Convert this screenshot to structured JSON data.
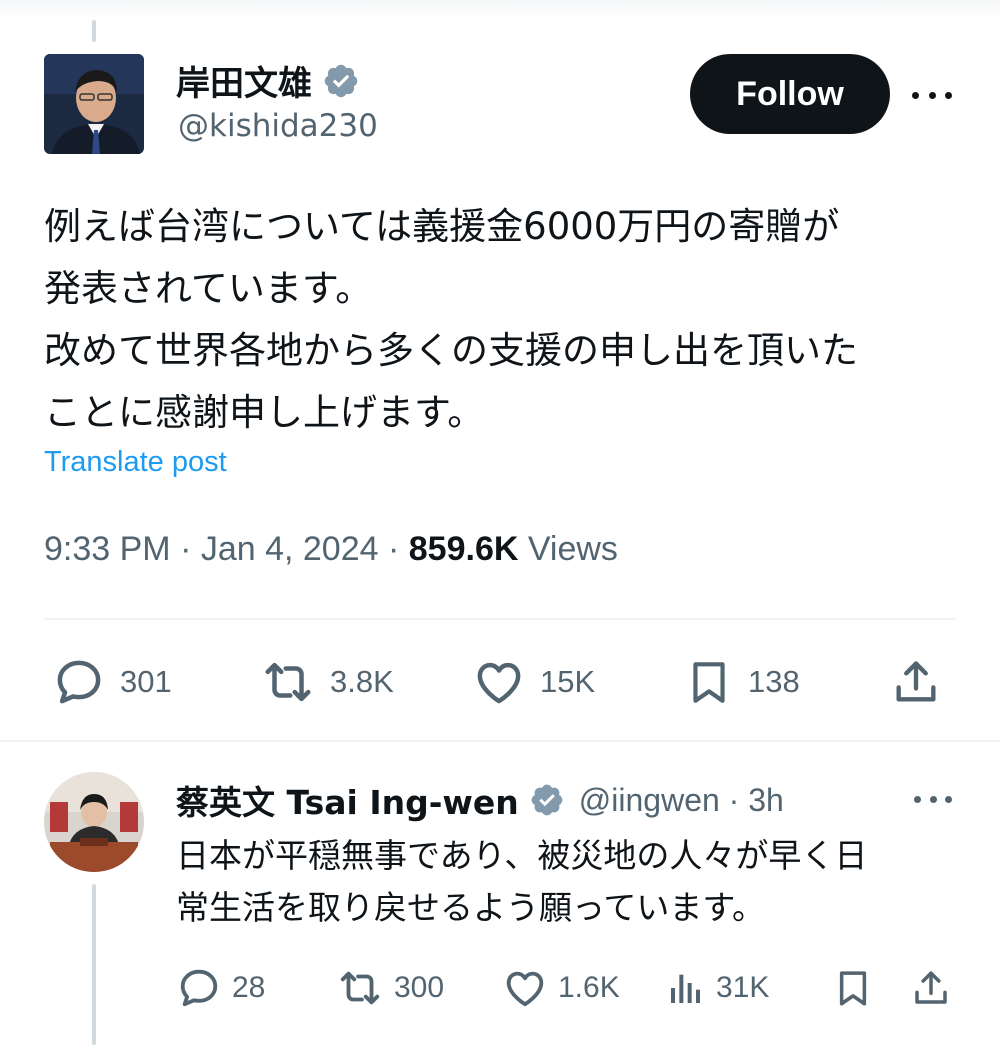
{
  "main_tweet": {
    "display_name": "岸田文雄",
    "handle": "@kishida230",
    "follow_label": "Follow",
    "text_lines": [
      "例えば台湾については義援金6000万円の寄贈が",
      "発表されています。",
      "改めて世界各地から多くの支援の申し出を頂いた",
      "ことに感謝申し上げます。"
    ],
    "translate_label": "Translate post",
    "timestamp": "9:33 PM · Jan 4, 2024 · ",
    "views_count": "859.6K",
    "views_label": " Views",
    "actions": {
      "replies": "301",
      "reposts": "3.8K",
      "likes": "15K",
      "bookmarks": "138"
    }
  },
  "reply": {
    "display_name": "蔡英文 Tsai Ing-wen",
    "handle_time": "@iingwen · 3h",
    "text_lines": [
      "日本が平穏無事であり、被災地の人々が早く日",
      "常生活を取り戻せるよう願っています。"
    ],
    "actions": {
      "replies": "28",
      "reposts": "300",
      "likes": "1.6K",
      "views": "31K"
    }
  },
  "colors": {
    "text": "#0f1419",
    "secondary": "#536471",
    "link": "#1d9bf0",
    "verified_badge": "#829aab",
    "follow_bg": "#0f1419"
  },
  "icons": [
    "verified-badge-icon",
    "more-icon",
    "reply-icon",
    "repost-icon",
    "like-icon",
    "bookmark-icon",
    "share-icon",
    "views-icon"
  ]
}
